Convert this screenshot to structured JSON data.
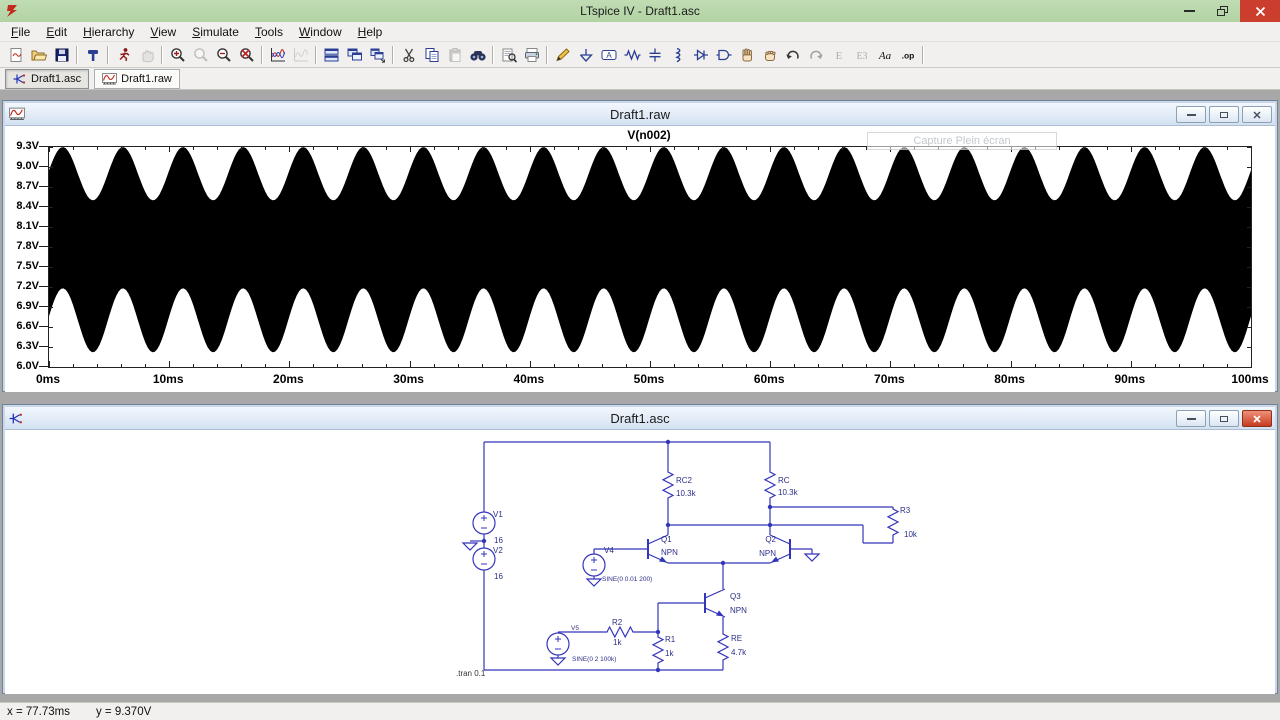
{
  "app": {
    "title": "LTspice IV - Draft1.asc"
  },
  "menu": [
    "File",
    "Edit",
    "Hierarchy",
    "View",
    "Simulate",
    "Tools",
    "Window",
    "Help"
  ],
  "toolbar": [
    {
      "name": "new-schematic"
    },
    {
      "name": "open"
    },
    {
      "name": "save"
    },
    {
      "sep": true
    },
    {
      "name": "control-panel"
    },
    {
      "sep": true
    },
    {
      "name": "run"
    },
    {
      "name": "halt",
      "disabled": true
    },
    {
      "sep": true
    },
    {
      "name": "zoom-in"
    },
    {
      "name": "zoom-area",
      "disabled": true
    },
    {
      "name": "zoom-out"
    },
    {
      "name": "zoom-full-extents"
    },
    {
      "sep": true
    },
    {
      "name": "autorange-y-axis"
    },
    {
      "name": "plot-settings",
      "disabled": true
    },
    {
      "sep": true
    },
    {
      "name": "tile-horizontally"
    },
    {
      "name": "tile-vertically"
    },
    {
      "name": "cascade-windows"
    },
    {
      "sep": true
    },
    {
      "name": "cut"
    },
    {
      "name": "copy"
    },
    {
      "name": "paste",
      "disabled": true
    },
    {
      "name": "find"
    },
    {
      "sep": true
    },
    {
      "name": "print-preview"
    },
    {
      "name": "print"
    },
    {
      "sep": true
    },
    {
      "name": "draw-wire"
    },
    {
      "name": "place-ground"
    },
    {
      "name": "place-net-label"
    },
    {
      "name": "place-resistor"
    },
    {
      "name": "place-capacitor"
    },
    {
      "name": "place-inductor"
    },
    {
      "name": "place-diode"
    },
    {
      "name": "place-component"
    },
    {
      "name": "move"
    },
    {
      "name": "drag"
    },
    {
      "name": "undo"
    },
    {
      "name": "redo",
      "disabled": true
    },
    {
      "name": "mirror",
      "disabled": true
    },
    {
      "name": "rotate",
      "disabled": true
    },
    {
      "name": "place-text"
    },
    {
      "name": "place-spice-directive"
    },
    {
      "sep": true
    }
  ],
  "tabs": [
    {
      "label": "Draft1.asc",
      "active": true
    },
    {
      "label": "Draft1.raw",
      "active": false
    }
  ],
  "raw_window": {
    "title": "Draft1.raw",
    "tooltip": "Capture Plein écran"
  },
  "chart_data": {
    "type": "area",
    "title": "V(n002)",
    "x_unit": "ms",
    "x_min": 0,
    "x_max": 100,
    "x_major_step": 10,
    "x_minor_step": 2,
    "y_unit": "V",
    "y_min": 6.0,
    "y_max": 9.3,
    "y_step": 0.3,
    "x_tick_labels": [
      "0ms",
      "10ms",
      "20ms",
      "30ms",
      "40ms",
      "50ms",
      "60ms",
      "70ms",
      "80ms",
      "90ms",
      "100ms"
    ],
    "y_tick_labels": [
      "9.3V",
      "9.0V",
      "8.7V",
      "8.4V",
      "8.1V",
      "7.8V",
      "7.5V",
      "7.2V",
      "6.9V",
      "6.6V",
      "6.3V",
      "6.0V"
    ],
    "grid": false,
    "trace_color": "#000000",
    "signal": {
      "description": "Solid black band: 100 kHz carrier with additive 200 Hz sinusoidal envelope, 20 envelope cycles over 100 ms",
      "carrier_hz": 100000,
      "envelope_hz": 200,
      "envelope_period_ms": 5,
      "envelope_peak_ms": 1.15,
      "top_edge_center_v": 8.9,
      "top_edge_amplitude_v": 0.4,
      "bottom_edge_center_v": 6.7,
      "bottom_edge_amplitude_v": 0.48
    }
  },
  "asc_window": {
    "title": "Draft1.asc",
    "directive": ".tran 0.1",
    "labels": {
      "v1_name": "V1",
      "v1_value": "16",
      "v2_name": "V2",
      "v2_value": "16",
      "v4_name": "V4",
      "v4_value": "SINE(0 0.01 200)",
      "v5_name": "V5",
      "v5_value": "SINE(0 2 100k)",
      "rc2_name": "RC2",
      "rc2_value": "10.3k",
      "rc_name": "RC",
      "rc_value": "10.3k",
      "r3_name": "R3",
      "r3_value": "10k",
      "r2_name": "R2",
      "r2_value": "1k",
      "r1_name": "R1",
      "r1_value": "1k",
      "re_name": "RE",
      "re_value": "4.7k",
      "q1_name": "Q1",
      "q1_value": "NPN",
      "q2_name": "Q2",
      "q2_value": "NPN",
      "q3_name": "Q3",
      "q3_value": "NPN"
    }
  },
  "status_bar": {
    "x_readout": "x = 77.73ms",
    "y_readout": "y = 9.370V"
  },
  "colors": {
    "titlebar_green": "#b7d6aa",
    "close_red": "#cb3d2c",
    "schematic_blue": "#3335bb",
    "schematic_text": "#2b2f86",
    "chrome_gray": "#f1f0ee",
    "mdi_background": "#a8a8a8",
    "child_titlebar": "#e3edf8"
  }
}
